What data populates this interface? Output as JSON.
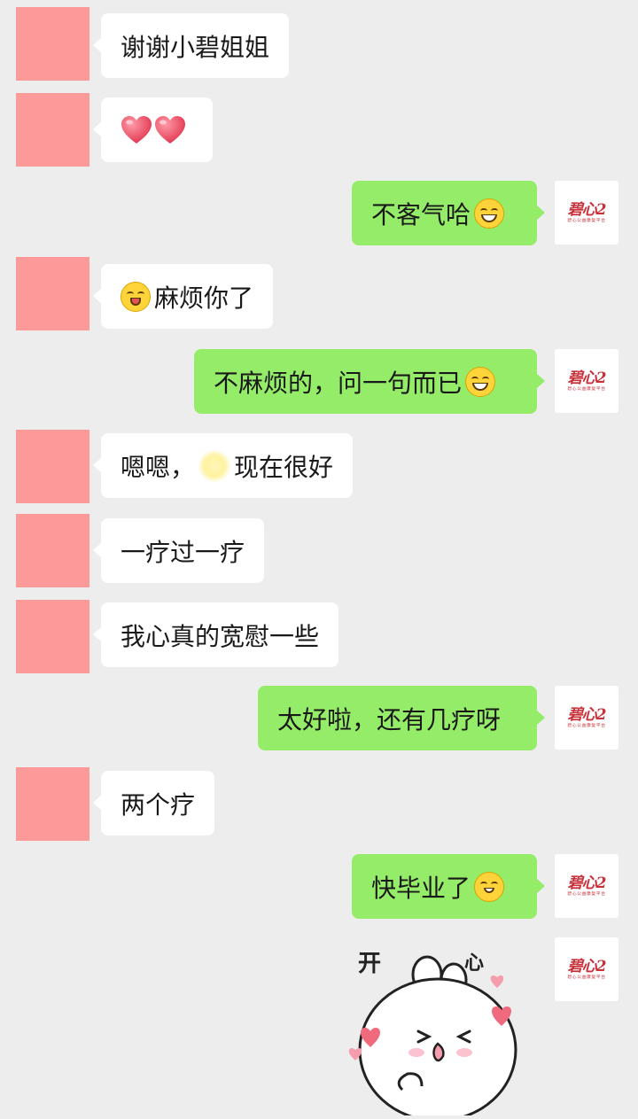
{
  "colors": {
    "background": "#ededed",
    "incoming_bubble": "#ffffff",
    "outgoing_bubble": "#95ec69",
    "sender_avatar_placeholder": "#fb9a99",
    "logo_red": "#c8313a"
  },
  "contact_logo": {
    "mark": "碧心2",
    "subtitle": "碧心公益康复平台"
  },
  "messages": [
    {
      "side": "left",
      "text": "谢谢小碧姐姐"
    },
    {
      "side": "left",
      "icons": [
        "heart-icon",
        "heart-icon"
      ]
    },
    {
      "side": "right",
      "text": "不客气哈",
      "trailing_icon": "grin-emoji-icon"
    },
    {
      "side": "left",
      "leading_icon": "wink-tongue-emoji-icon",
      "text": "麻烦你了"
    },
    {
      "side": "right",
      "text": "不麻烦的，问一句而已",
      "trailing_icon": "big-grin-emoji-icon"
    },
    {
      "side": "left",
      "text_before": "嗯嗯，",
      "inline_icon": "blurred-emoji-icon",
      "text_after": "现在很好"
    },
    {
      "side": "left",
      "text": "一疗过一疗"
    },
    {
      "side": "left",
      "text": "我心真的宽慰一些"
    },
    {
      "side": "right",
      "text": "太好啦，还有几疗呀"
    },
    {
      "side": "left",
      "text": "两个疗"
    },
    {
      "side": "right",
      "text": "快毕业了",
      "trailing_icon": "smirk-emoji-icon"
    },
    {
      "side": "right",
      "sticker": "happy-bunny-sticker",
      "sticker_text": [
        "开",
        "心"
      ]
    }
  ]
}
